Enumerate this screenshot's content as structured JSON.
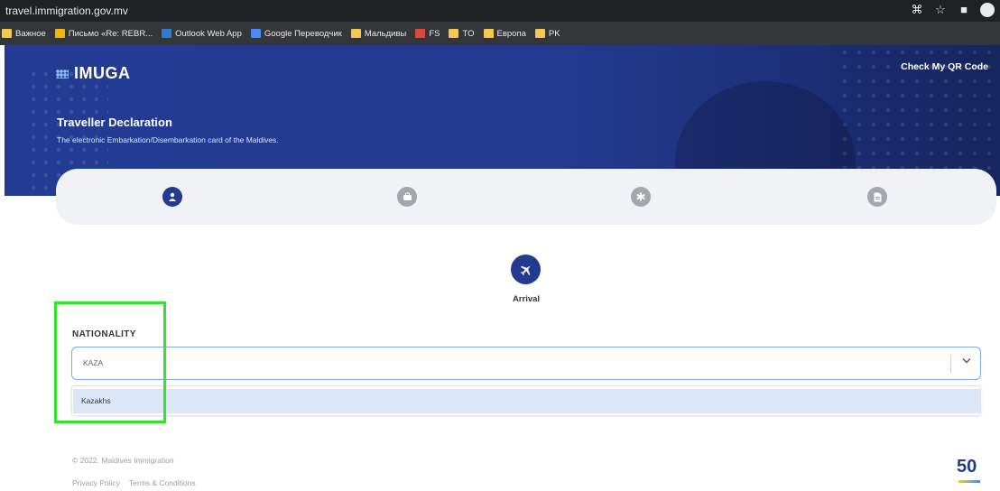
{
  "browser": {
    "url": "travel.immigration.gov.mv",
    "bookmarks": [
      {
        "label": "Важное",
        "icon": "folder-icon"
      },
      {
        "label": "Письмо «Re: REBR...",
        "icon": "gmail-icon"
      },
      {
        "label": "Outlook Web App",
        "icon": "outlook-icon"
      },
      {
        "label": "Google Переводчик",
        "icon": "translate-icon"
      },
      {
        "label": "Мальдивы",
        "icon": "folder-icon"
      },
      {
        "label": "FS",
        "icon": "fs-icon"
      },
      {
        "label": "TO",
        "icon": "folder-icon"
      },
      {
        "label": "Европа",
        "icon": "folder-icon"
      },
      {
        "label": "PK",
        "icon": "folder-icon"
      }
    ]
  },
  "header": {
    "logo": "IMUGA",
    "qr_link": "Check My QR Code",
    "title": "Traveller Declaration",
    "subtitle": "The electronic Embarkation/Disembarkation card of the Maldives."
  },
  "steps": [
    {
      "icon": "user-icon",
      "active": true
    },
    {
      "icon": "luggage-icon",
      "active": false
    },
    {
      "icon": "health-icon",
      "active": false
    },
    {
      "icon": "document-icon",
      "active": false
    }
  ],
  "arrival": {
    "label": "Arrival",
    "icon": "plane-icon"
  },
  "nationality": {
    "label": "NATIONALITY",
    "value": "KAZA",
    "options": [
      "Kazakhs"
    ]
  },
  "footer": {
    "copyright": "© 2022. Maldives Immigration",
    "privacy": "Privacy Policy",
    "terms": "Terms & Conditions",
    "badge": "50"
  },
  "colors": {
    "primary": "#243a90",
    "highlight": "#32e52c",
    "option_bg": "#dbe7f8"
  }
}
